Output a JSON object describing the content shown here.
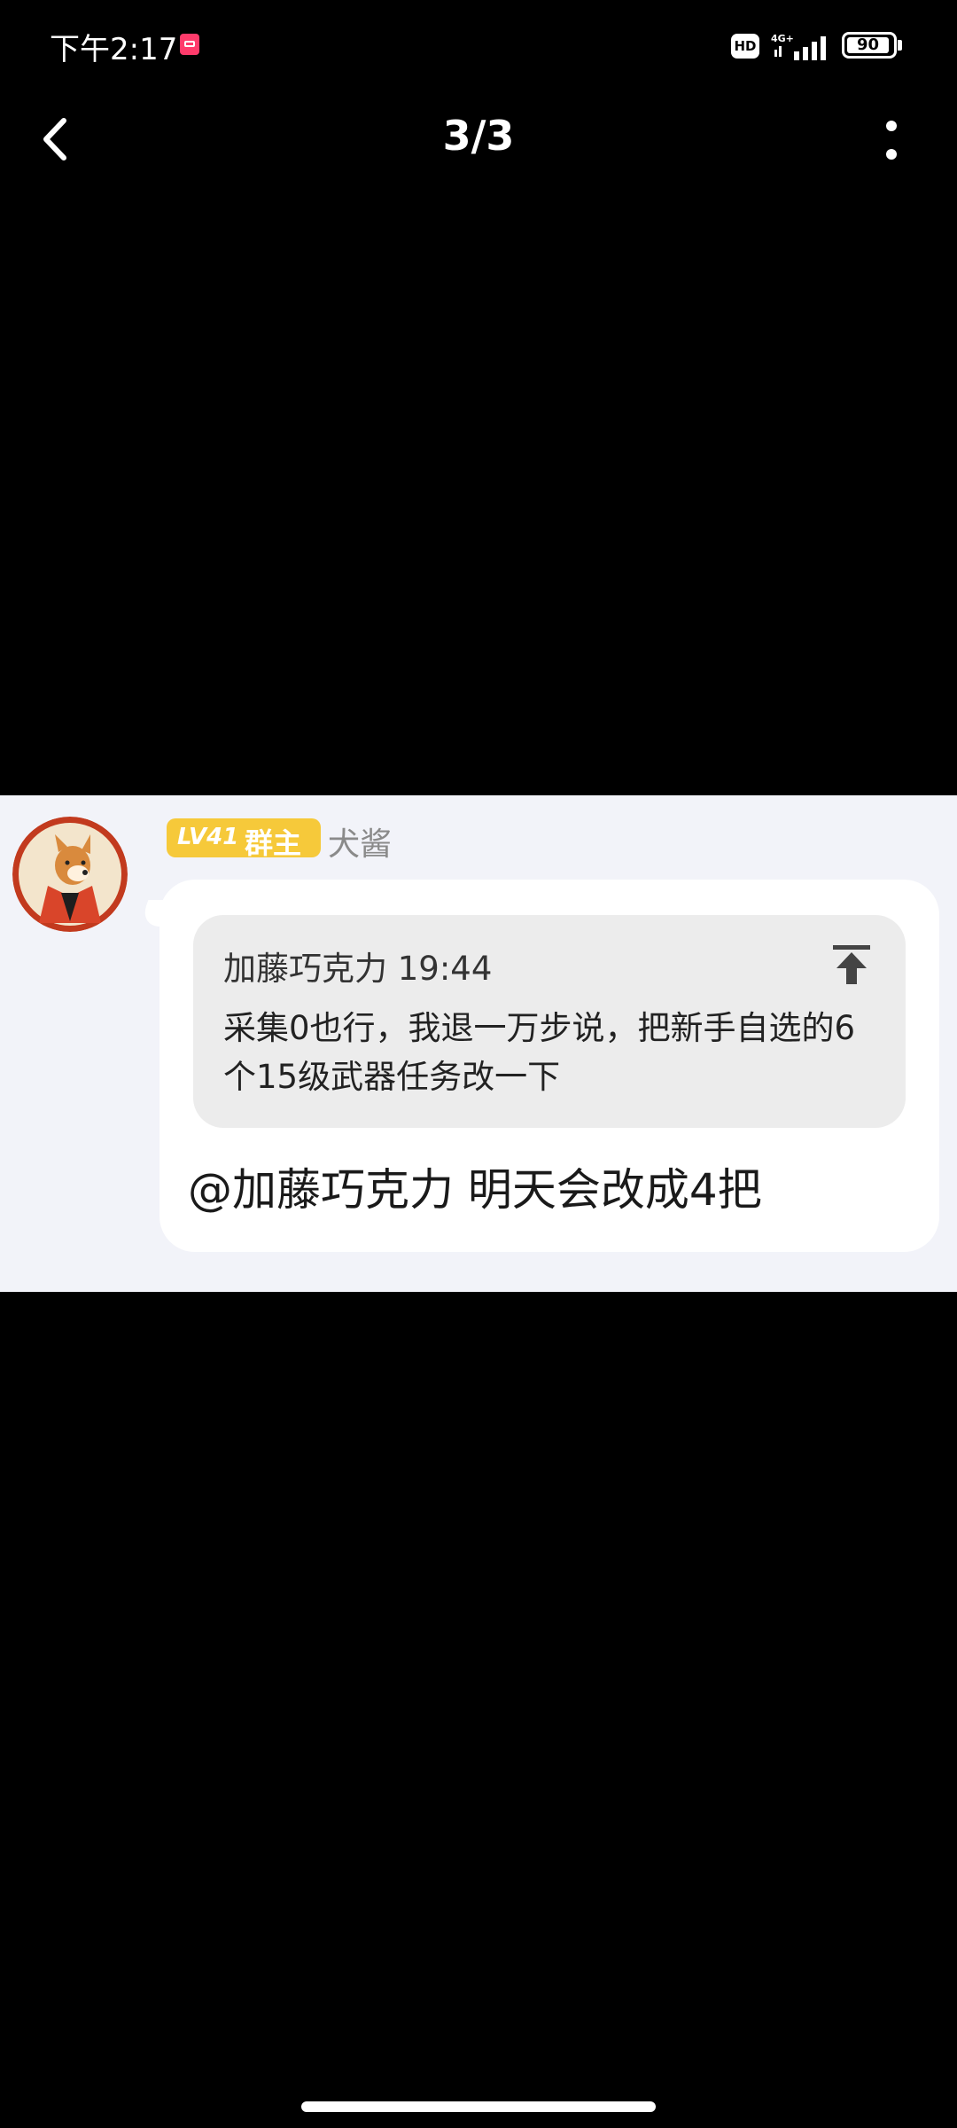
{
  "status_bar": {
    "time": "下午2:17",
    "hd_label": "HD",
    "network": "4G+",
    "battery": "90",
    "app_icon": "notification-app-icon"
  },
  "top_nav": {
    "page_counter": "3/3",
    "back_icon": "chevron-left-icon",
    "more_icon": "more-vertical-icon"
  },
  "message": {
    "level_badge": "LV41",
    "role_badge": "群主",
    "sender": "犬酱",
    "quote": {
      "author_time": "加藤巧克力 19:44",
      "body": "采集0也行，我退一万步说，把新手自选的6个15级武器任务改一下",
      "icon": "scroll-to-top-icon"
    },
    "reply": "@加藤巧克力 明天会改成4把"
  },
  "colors": {
    "background": "#000000",
    "panel": "#f2f3f9",
    "badge": "#f6c93a",
    "bubble": "#ffffff",
    "quote_bg": "#ececec"
  }
}
